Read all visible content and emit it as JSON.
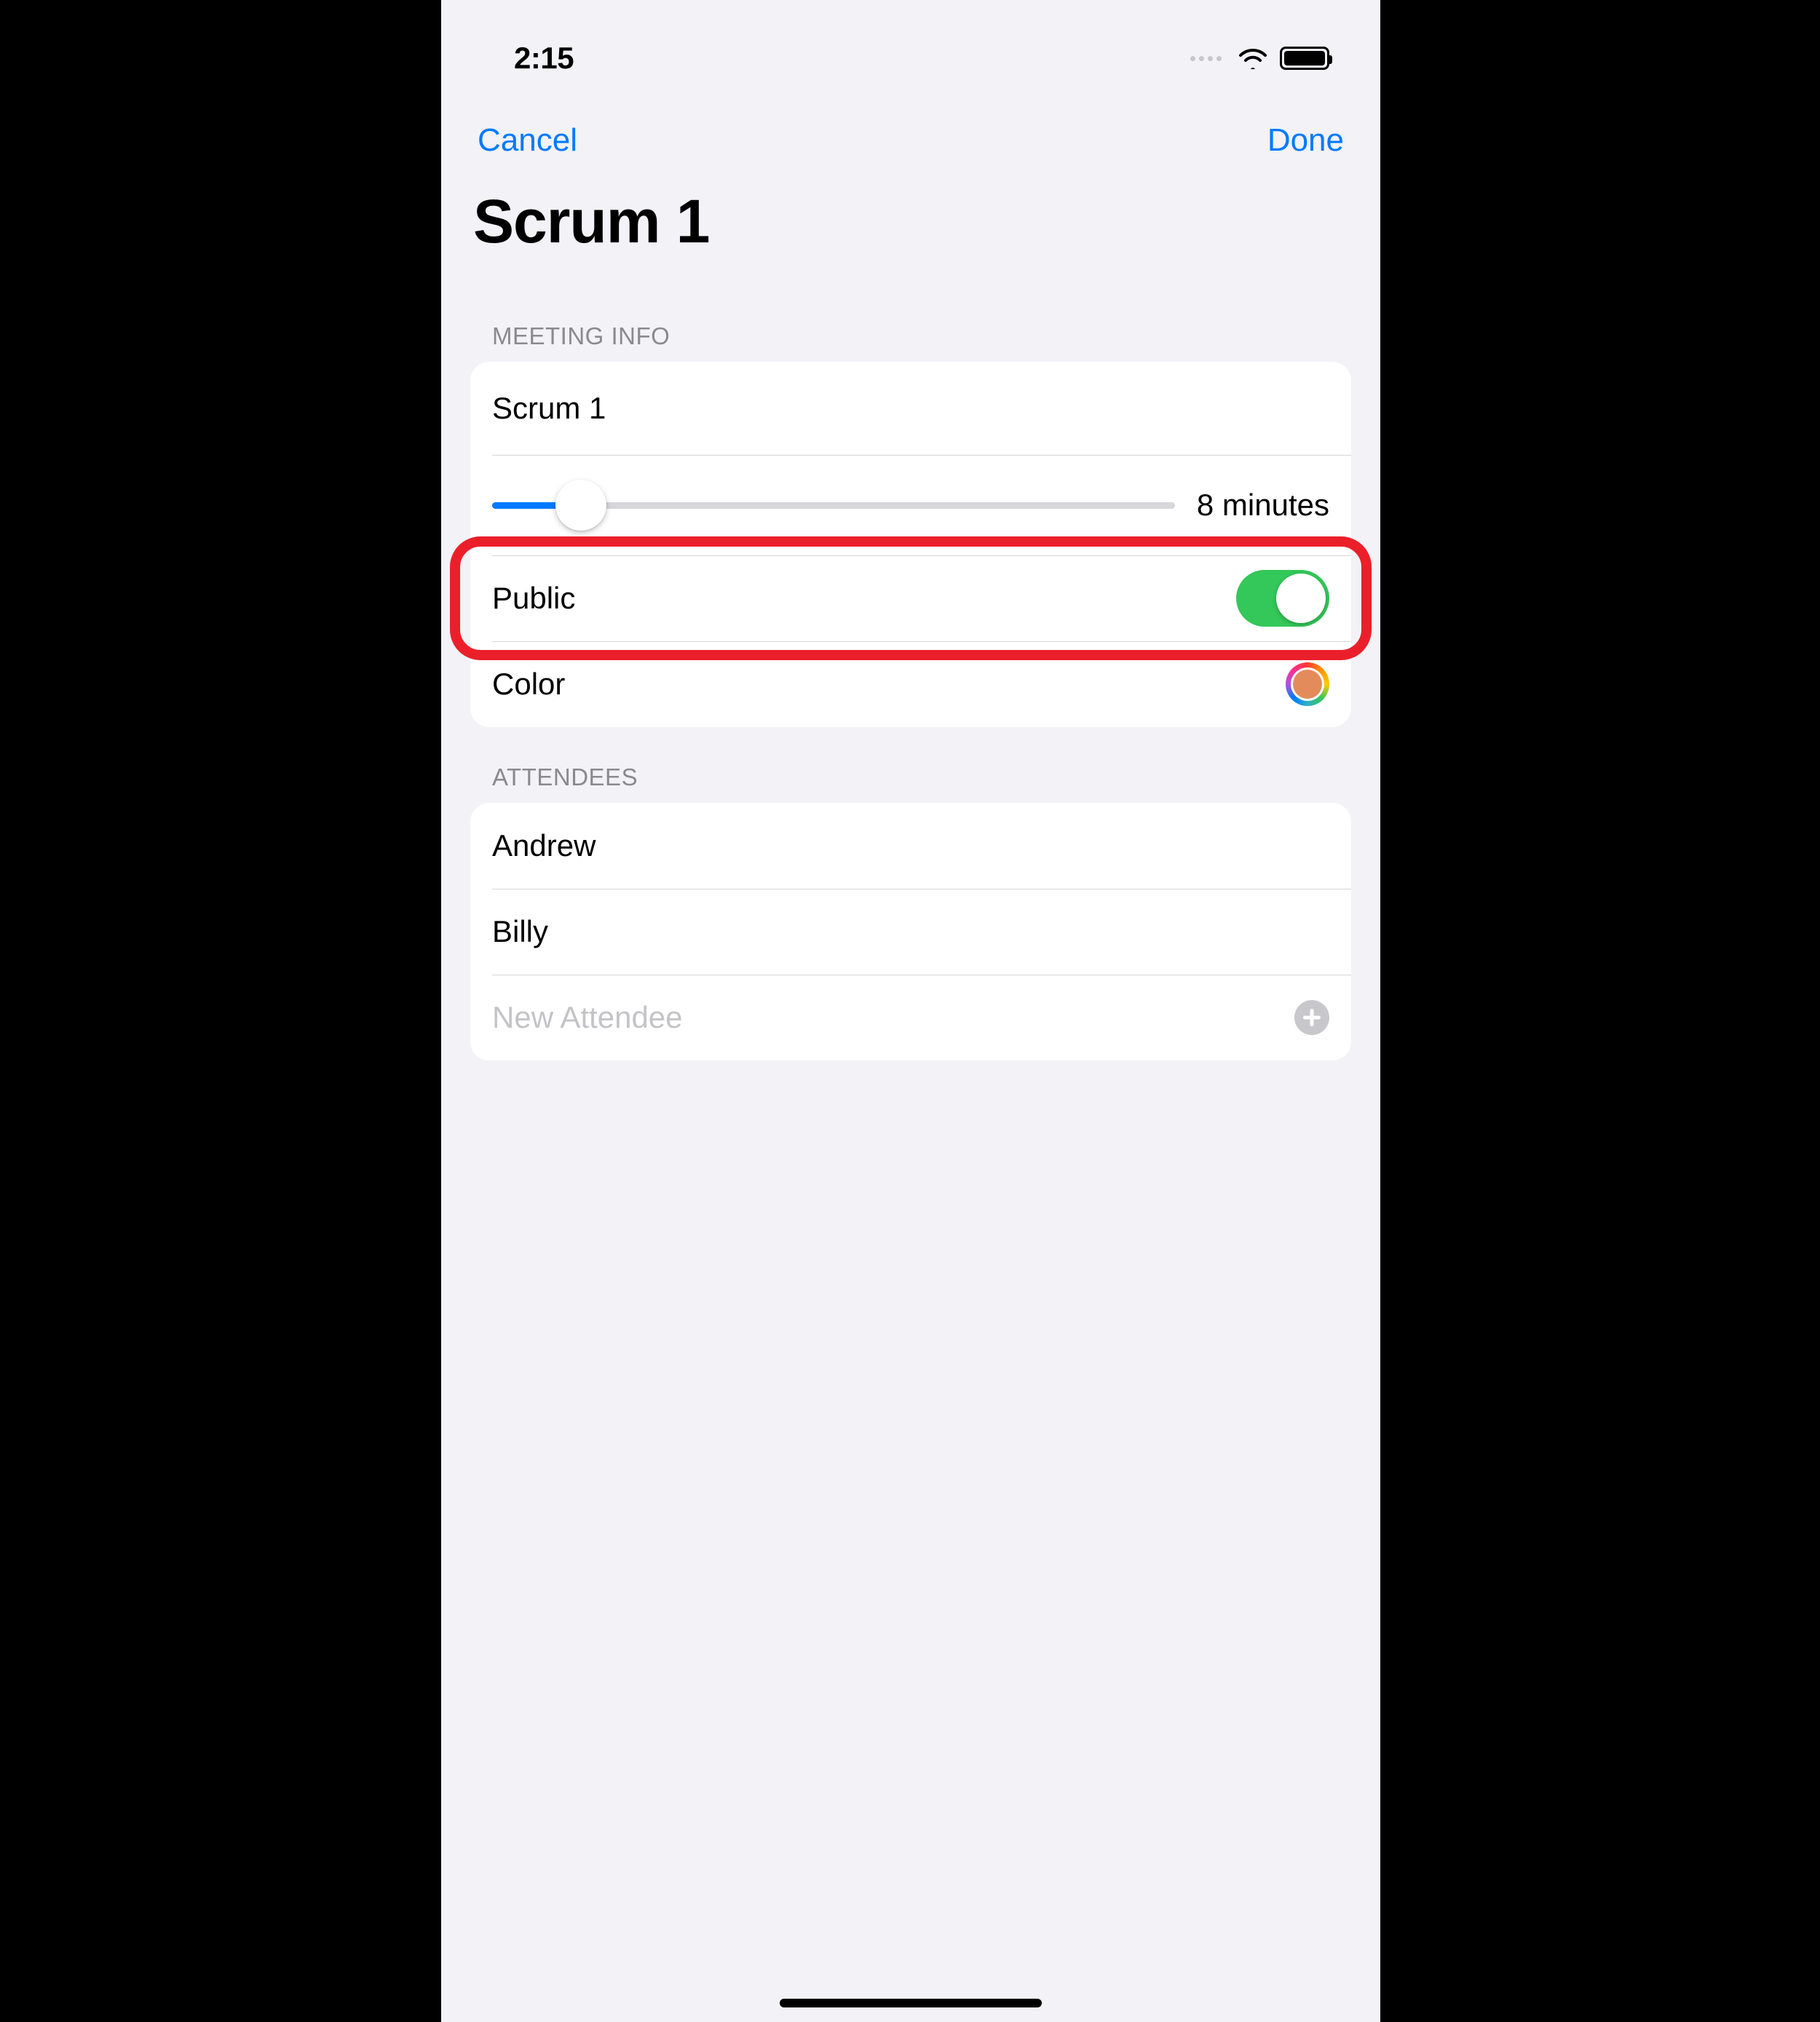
{
  "status": {
    "time": "2:15"
  },
  "nav": {
    "cancel": "Cancel",
    "done": "Done"
  },
  "page_title": "Scrum 1",
  "sections": {
    "meeting_info_header": "MEETING INFO",
    "attendees_header": "ATTENDEES"
  },
  "meeting": {
    "title_value": "Scrum 1",
    "duration_label": "8 minutes",
    "duration_fill_percent": 11,
    "public_label": "Public",
    "public_on": true,
    "color_label": "Color",
    "color_hex": "#e38b5b"
  },
  "attendees": {
    "items": [
      "Andrew",
      "Billy"
    ],
    "new_placeholder": "New Attendee"
  },
  "highlight": {
    "row": "public"
  }
}
